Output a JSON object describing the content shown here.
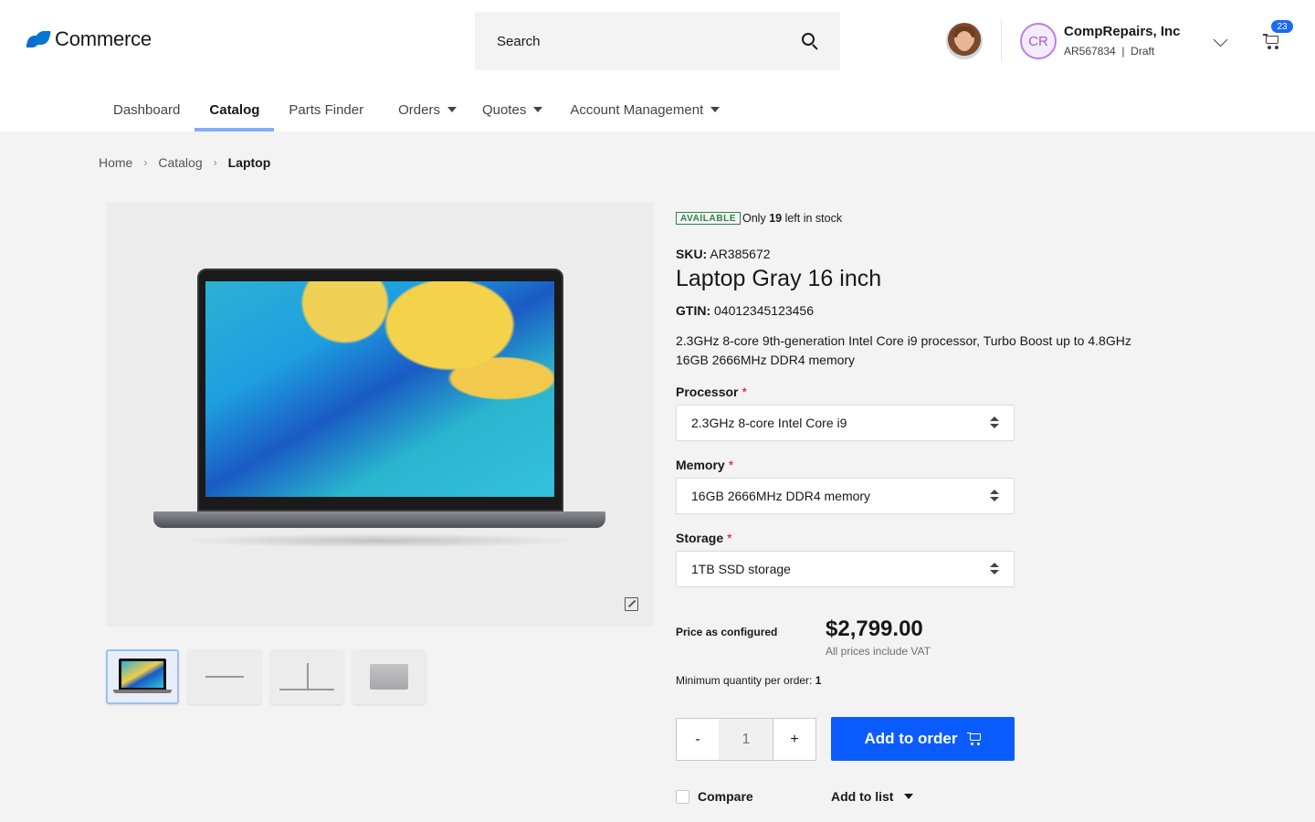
{
  "header": {
    "brand": "Commerce",
    "search_label": "Search",
    "account": {
      "initials": "CR",
      "name": "CompRepairs, Inc",
      "sub": "AR567834  |  Draft"
    },
    "cart_count": "23"
  },
  "nav": {
    "items": [
      {
        "label": "Dashboard"
      },
      {
        "label": "Catalog"
      },
      {
        "label": "Parts Finder"
      },
      {
        "label": "Orders"
      },
      {
        "label": "Quotes"
      },
      {
        "label": "Account Management"
      }
    ]
  },
  "breadcrumb": [
    "Home",
    "Catalog",
    "Laptop"
  ],
  "product": {
    "availability": "AVAILABLE",
    "stock_prefix": "Only",
    "stock_count": "19",
    "stock_suffix": "left in stock",
    "sku_label": "SKU:",
    "sku": "AR385672",
    "title": "Laptop Gray 16 inch",
    "gtin_label": "GTIN:",
    "gtin": "04012345123456",
    "desc_line1": "2.3GHz 8-core 9th-generation Intel Core i9 processor, Turbo Boost up to 4.8GHz",
    "desc_line2": "16GB 2666MHz DDR4 memory",
    "options": [
      {
        "label": "Processor",
        "required": "*",
        "value": "2.3GHz 8-core Intel Core i9"
      },
      {
        "label": "Memory",
        "required": "*",
        "value": "16GB 2666MHz DDR4 memory"
      },
      {
        "label": "Storage",
        "required": "*",
        "value": "1TB SSD storage"
      }
    ],
    "price_label": "Price as configured",
    "price": "$2,799.00",
    "vat_note": "All prices include VAT",
    "min_qty_label": "Minimum quantity per order:",
    "min_qty": "1",
    "qty_minus": "-",
    "qty_value": "1",
    "qty_plus": "+",
    "add_button": "Add to order",
    "compare_label": "Compare",
    "add_list_label": "Add to list"
  },
  "colors": {
    "primary": "#0b5cff",
    "available": "#2e844a",
    "required": "#ea001e",
    "avatar_accent": "#b880e8"
  }
}
